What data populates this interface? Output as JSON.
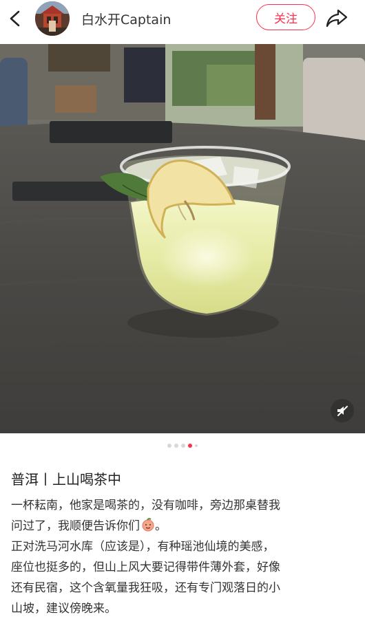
{
  "header": {
    "author_name": "白水开Captain",
    "follow_label": "关注"
  },
  "carousel": {
    "total": 5,
    "active_index": 3
  },
  "colors": {
    "accent": "#ff2e4d",
    "text": "#333333"
  },
  "icons": {
    "back": "chevron-left-icon",
    "share": "share-arrow-icon",
    "mute": "speaker-mute-icon",
    "emoji": "peach-face-emoji"
  },
  "post": {
    "title": "普洱丨上山喝茶中",
    "lines": [
      "一杯耘南，他家是喝茶的，没有咖啡，旁边那桌替我",
      "问过了，我顺便告诉你们",
      "。",
      "正对洗马河水库（应该是），有种瑶池仙境的美感，",
      "座位也挺多的，但山上风大要记得带件薄外套，好像",
      "还有民宿，这个含氧量我狂吸，还有专门观落日的小",
      "山坡，建议傍晚来。"
    ]
  }
}
